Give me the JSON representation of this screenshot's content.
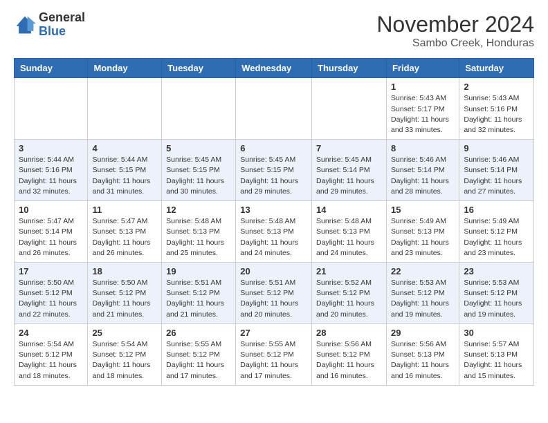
{
  "header": {
    "logo_general": "General",
    "logo_blue": "Blue",
    "month_title": "November 2024",
    "subtitle": "Sambo Creek, Honduras"
  },
  "weekdays": [
    "Sunday",
    "Monday",
    "Tuesday",
    "Wednesday",
    "Thursday",
    "Friday",
    "Saturday"
  ],
  "weeks": [
    [
      {
        "day": "",
        "info": ""
      },
      {
        "day": "",
        "info": ""
      },
      {
        "day": "",
        "info": ""
      },
      {
        "day": "",
        "info": ""
      },
      {
        "day": "",
        "info": ""
      },
      {
        "day": "1",
        "info": "Sunrise: 5:43 AM\nSunset: 5:17 PM\nDaylight: 11 hours\nand 33 minutes."
      },
      {
        "day": "2",
        "info": "Sunrise: 5:43 AM\nSunset: 5:16 PM\nDaylight: 11 hours\nand 32 minutes."
      }
    ],
    [
      {
        "day": "3",
        "info": "Sunrise: 5:44 AM\nSunset: 5:16 PM\nDaylight: 11 hours\nand 32 minutes."
      },
      {
        "day": "4",
        "info": "Sunrise: 5:44 AM\nSunset: 5:15 PM\nDaylight: 11 hours\nand 31 minutes."
      },
      {
        "day": "5",
        "info": "Sunrise: 5:45 AM\nSunset: 5:15 PM\nDaylight: 11 hours\nand 30 minutes."
      },
      {
        "day": "6",
        "info": "Sunrise: 5:45 AM\nSunset: 5:15 PM\nDaylight: 11 hours\nand 29 minutes."
      },
      {
        "day": "7",
        "info": "Sunrise: 5:45 AM\nSunset: 5:14 PM\nDaylight: 11 hours\nand 29 minutes."
      },
      {
        "day": "8",
        "info": "Sunrise: 5:46 AM\nSunset: 5:14 PM\nDaylight: 11 hours\nand 28 minutes."
      },
      {
        "day": "9",
        "info": "Sunrise: 5:46 AM\nSunset: 5:14 PM\nDaylight: 11 hours\nand 27 minutes."
      }
    ],
    [
      {
        "day": "10",
        "info": "Sunrise: 5:47 AM\nSunset: 5:14 PM\nDaylight: 11 hours\nand 26 minutes."
      },
      {
        "day": "11",
        "info": "Sunrise: 5:47 AM\nSunset: 5:13 PM\nDaylight: 11 hours\nand 26 minutes."
      },
      {
        "day": "12",
        "info": "Sunrise: 5:48 AM\nSunset: 5:13 PM\nDaylight: 11 hours\nand 25 minutes."
      },
      {
        "day": "13",
        "info": "Sunrise: 5:48 AM\nSunset: 5:13 PM\nDaylight: 11 hours\nand 24 minutes."
      },
      {
        "day": "14",
        "info": "Sunrise: 5:48 AM\nSunset: 5:13 PM\nDaylight: 11 hours\nand 24 minutes."
      },
      {
        "day": "15",
        "info": "Sunrise: 5:49 AM\nSunset: 5:13 PM\nDaylight: 11 hours\nand 23 minutes."
      },
      {
        "day": "16",
        "info": "Sunrise: 5:49 AM\nSunset: 5:12 PM\nDaylight: 11 hours\nand 23 minutes."
      }
    ],
    [
      {
        "day": "17",
        "info": "Sunrise: 5:50 AM\nSunset: 5:12 PM\nDaylight: 11 hours\nand 22 minutes."
      },
      {
        "day": "18",
        "info": "Sunrise: 5:50 AM\nSunset: 5:12 PM\nDaylight: 11 hours\nand 21 minutes."
      },
      {
        "day": "19",
        "info": "Sunrise: 5:51 AM\nSunset: 5:12 PM\nDaylight: 11 hours\nand 21 minutes."
      },
      {
        "day": "20",
        "info": "Sunrise: 5:51 AM\nSunset: 5:12 PM\nDaylight: 11 hours\nand 20 minutes."
      },
      {
        "day": "21",
        "info": "Sunrise: 5:52 AM\nSunset: 5:12 PM\nDaylight: 11 hours\nand 20 minutes."
      },
      {
        "day": "22",
        "info": "Sunrise: 5:53 AM\nSunset: 5:12 PM\nDaylight: 11 hours\nand 19 minutes."
      },
      {
        "day": "23",
        "info": "Sunrise: 5:53 AM\nSunset: 5:12 PM\nDaylight: 11 hours\nand 19 minutes."
      }
    ],
    [
      {
        "day": "24",
        "info": "Sunrise: 5:54 AM\nSunset: 5:12 PM\nDaylight: 11 hours\nand 18 minutes."
      },
      {
        "day": "25",
        "info": "Sunrise: 5:54 AM\nSunset: 5:12 PM\nDaylight: 11 hours\nand 18 minutes."
      },
      {
        "day": "26",
        "info": "Sunrise: 5:55 AM\nSunset: 5:12 PM\nDaylight: 11 hours\nand 17 minutes."
      },
      {
        "day": "27",
        "info": "Sunrise: 5:55 AM\nSunset: 5:12 PM\nDaylight: 11 hours\nand 17 minutes."
      },
      {
        "day": "28",
        "info": "Sunrise: 5:56 AM\nSunset: 5:12 PM\nDaylight: 11 hours\nand 16 minutes."
      },
      {
        "day": "29",
        "info": "Sunrise: 5:56 AM\nSunset: 5:13 PM\nDaylight: 11 hours\nand 16 minutes."
      },
      {
        "day": "30",
        "info": "Sunrise: 5:57 AM\nSunset: 5:13 PM\nDaylight: 11 hours\nand 15 minutes."
      }
    ]
  ]
}
